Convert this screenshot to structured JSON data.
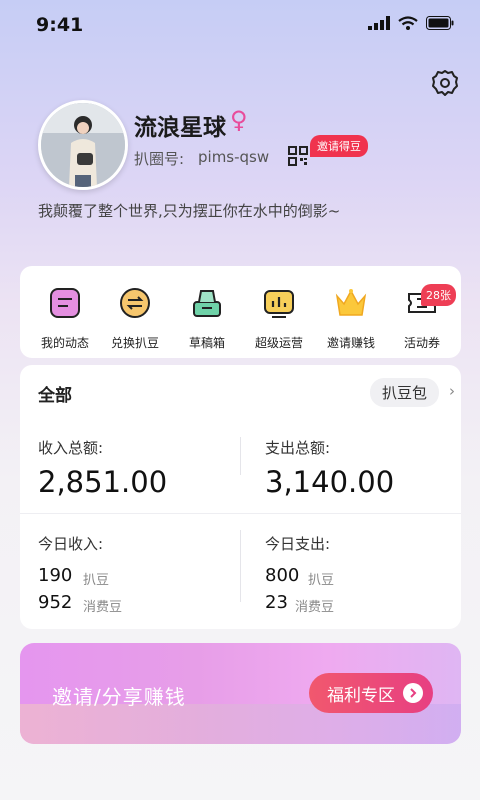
{
  "status": {
    "time": "9:41"
  },
  "profile": {
    "name": "流浪星球",
    "gender_symbol": "♀",
    "id_label": "扒圈号:",
    "id_value": "pims-qsw",
    "invite_badge": "邀请得豆",
    "bio": "我颠覆了整个世界,只为摆正你在水中的倒影~"
  },
  "quick_actions": [
    {
      "label": "我的动态",
      "icon": "note-icon"
    },
    {
      "label": "兑换扒豆",
      "icon": "exchange-icon"
    },
    {
      "label": "草稿箱",
      "icon": "drafts-icon"
    },
    {
      "label": "超级运营",
      "icon": "chart-icon"
    },
    {
      "label": "邀请赚钱",
      "icon": "crown-icon"
    },
    {
      "label": "活动券",
      "icon": "ticket-icon"
    }
  ],
  "coupon_badge": "28张",
  "stats": {
    "filter_label": "全部",
    "bean_pack": "扒豆包",
    "income_total_label": "收入总额:",
    "income_total": "2,851.00",
    "expense_total_label": "支出总额:",
    "expense_total": "3,140.00",
    "today_income_label": "今日收入:",
    "today_expense_label": "今日支出:",
    "today_income": [
      {
        "value": "190",
        "unit": "扒豆"
      },
      {
        "value": "952",
        "unit": "消费豆"
      }
    ],
    "today_expense": [
      {
        "value": "800",
        "unit": "扒豆"
      },
      {
        "value": "23",
        "unit": "消费豆"
      }
    ]
  },
  "banner": {
    "text": "邀请/分享赚钱",
    "button": "福利专区"
  },
  "colors": {
    "accent": "#f0334e",
    "gender": "#e84c9b",
    "banner_button": "#e73f82"
  }
}
